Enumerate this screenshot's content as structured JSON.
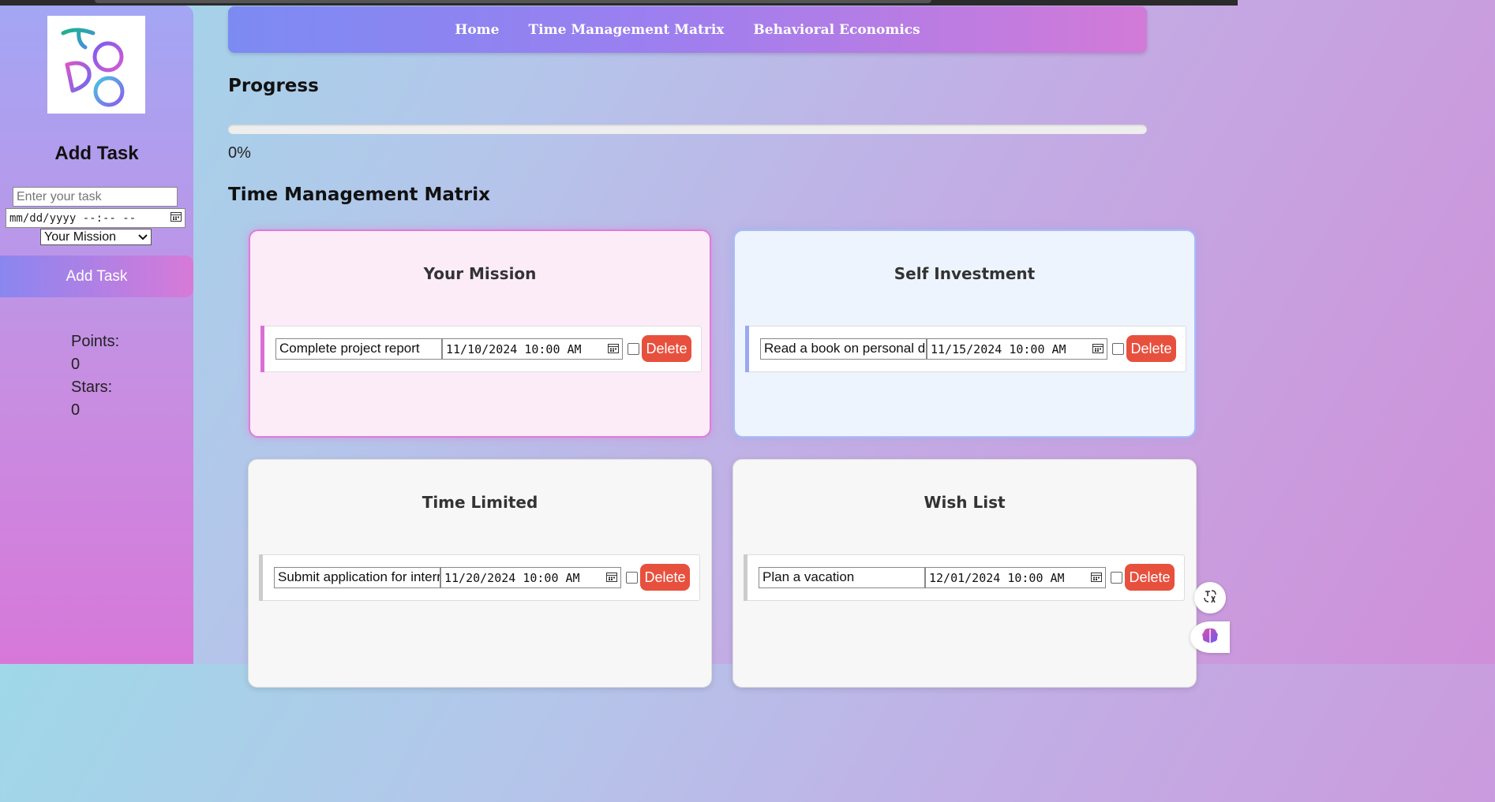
{
  "sidebar": {
    "title": "Add Task",
    "task_input_placeholder": "Enter your task",
    "datetime_placeholder": "mm/dd/yyyy --:-- --",
    "category_selected": "Your Mission",
    "add_button": "Add Task",
    "points_label": "Points:",
    "points_value": "0",
    "stars_label": "Stars:",
    "stars_value": "0"
  },
  "nav": {
    "links": [
      "Home",
      "Time Management Matrix",
      "Behavioral Economics"
    ]
  },
  "progress": {
    "heading": "Progress",
    "value_text": "0%",
    "fraction": 0
  },
  "matrix": {
    "heading": "Time Management Matrix",
    "quadrants": [
      {
        "title": "Your Mission",
        "accent": "#d96fd6",
        "task": {
          "text": "Complete project report",
          "date": "11/10/2024 10:00 AM"
        }
      },
      {
        "title": "Self Investment",
        "accent": "#9aa8f2",
        "task": {
          "text": "Read a book on personal de",
          "date": "11/15/2024 10:00 AM"
        }
      },
      {
        "title": "Time Limited",
        "accent": "#cccccc",
        "task": {
          "text": "Submit application for interr",
          "date": "11/20/2024 10:00 AM"
        }
      },
      {
        "title": "Wish List",
        "accent": "#cccccc",
        "task": {
          "text": "Plan a vacation",
          "date": "12/01/2024 10:00 AM"
        }
      }
    ],
    "delete_label": "Delete"
  },
  "colors": {
    "delete_red": "#e8503e",
    "nav_gradient_start": "#7c8bf2",
    "nav_gradient_end": "#d27ad8"
  }
}
